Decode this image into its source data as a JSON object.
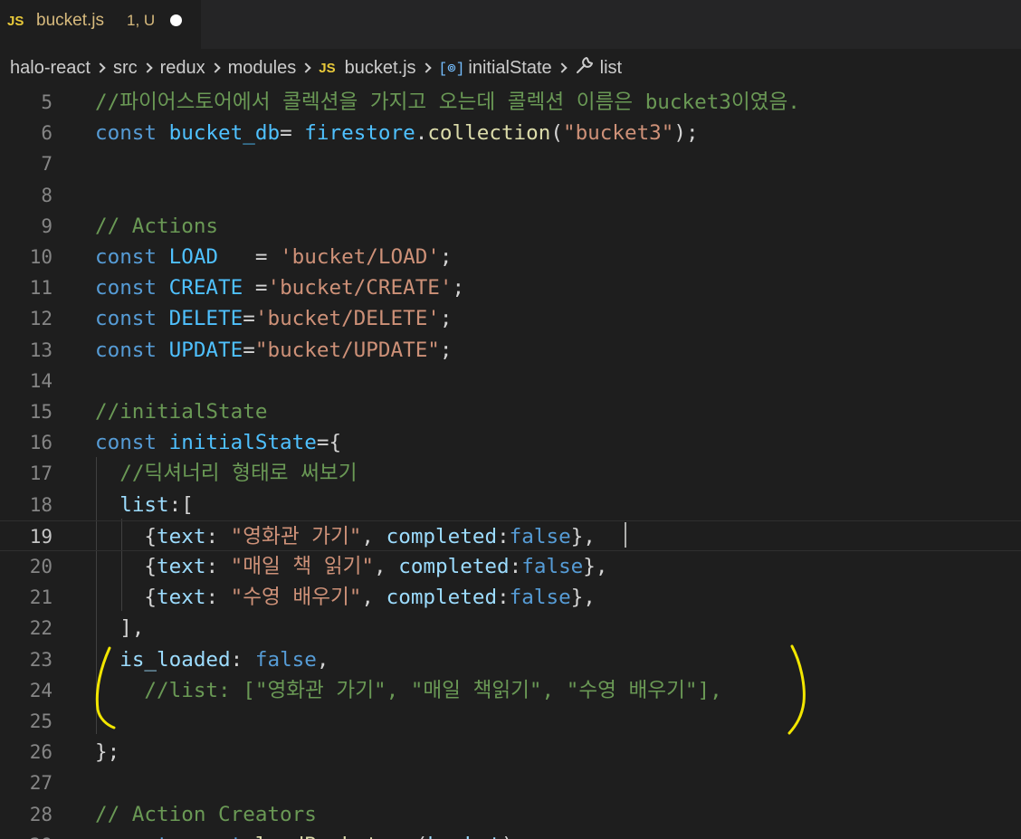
{
  "tab": {
    "icon": "JS",
    "title": "bucket.js",
    "status": "1, U"
  },
  "breadcrumb": {
    "items": [
      "halo-react",
      "src",
      "redux",
      "modules"
    ],
    "file_icon": "JS",
    "file": "bucket.js",
    "symbol_icon": "[⊚]",
    "symbol": "initialState",
    "property": "list"
  },
  "editor": {
    "lines": [
      {
        "num": "5",
        "current": false,
        "tokens": [
          [
            "cmt",
            "//파이어스토어에서 콜렉션을 가지고 오는데 콜렉션 이름은 bucket3이였음."
          ]
        ]
      },
      {
        "num": "6",
        "current": false,
        "tokens": [
          [
            "kw",
            "const"
          ],
          [
            "pun",
            " "
          ],
          [
            "var",
            "bucket_db"
          ],
          [
            "pun",
            "= "
          ],
          [
            "var",
            "firestore"
          ],
          [
            "pun",
            "."
          ],
          [
            "fn",
            "collection"
          ],
          [
            "pun",
            "("
          ],
          [
            "str",
            "\"bucket3\""
          ],
          [
            "pun",
            ");"
          ]
        ]
      },
      {
        "num": "7",
        "current": false,
        "tokens": []
      },
      {
        "num": "8",
        "current": false,
        "tokens": []
      },
      {
        "num": "9",
        "current": false,
        "tokens": [
          [
            "cmt",
            "// Actions"
          ]
        ]
      },
      {
        "num": "10",
        "current": false,
        "tokens": [
          [
            "kw",
            "const"
          ],
          [
            "pun",
            " "
          ],
          [
            "var",
            "LOAD"
          ],
          [
            "pun",
            "   = "
          ],
          [
            "str",
            "'bucket/LOAD'"
          ],
          [
            "pun",
            ";"
          ]
        ]
      },
      {
        "num": "11",
        "current": false,
        "tokens": [
          [
            "kw",
            "const"
          ],
          [
            "pun",
            " "
          ],
          [
            "var",
            "CREATE"
          ],
          [
            "pun",
            " ="
          ],
          [
            "str",
            "'bucket/CREATE'"
          ],
          [
            "pun",
            ";"
          ]
        ]
      },
      {
        "num": "12",
        "current": false,
        "tokens": [
          [
            "kw",
            "const"
          ],
          [
            "pun",
            " "
          ],
          [
            "var",
            "DELETE"
          ],
          [
            "pun",
            "="
          ],
          [
            "str",
            "'bucket/DELETE'"
          ],
          [
            "pun",
            ";"
          ]
        ]
      },
      {
        "num": "13",
        "current": false,
        "tokens": [
          [
            "kw",
            "const"
          ],
          [
            "pun",
            " "
          ],
          [
            "var",
            "UPDATE"
          ],
          [
            "pun",
            "="
          ],
          [
            "str",
            "\"bucket/UPDATE\""
          ],
          [
            "pun",
            ";"
          ]
        ]
      },
      {
        "num": "14",
        "current": false,
        "tokens": []
      },
      {
        "num": "15",
        "current": false,
        "tokens": [
          [
            "cmt",
            "//initialState"
          ]
        ]
      },
      {
        "num": "16",
        "current": false,
        "tokens": [
          [
            "kw",
            "const"
          ],
          [
            "pun",
            " "
          ],
          [
            "var",
            "initialState"
          ],
          [
            "pun",
            "={"
          ]
        ]
      },
      {
        "num": "17",
        "current": false,
        "tokens": [
          [
            "pun",
            "  "
          ],
          [
            "cmt",
            "//딕셔너리 형태로 써보기"
          ]
        ]
      },
      {
        "num": "18",
        "current": false,
        "tokens": [
          [
            "pun",
            "  "
          ],
          [
            "prop",
            "list"
          ],
          [
            "pun",
            ":["
          ]
        ]
      },
      {
        "num": "19",
        "current": true,
        "tokens": [
          [
            "pun",
            "    {"
          ],
          [
            "prop",
            "text"
          ],
          [
            "pun",
            ": "
          ],
          [
            "str",
            "\"영화관 가기\""
          ],
          [
            "pun",
            ", "
          ],
          [
            "prop",
            "completed"
          ],
          [
            "pun",
            ":"
          ],
          [
            "bool",
            "false"
          ],
          [
            "pun",
            "},"
          ]
        ]
      },
      {
        "num": "20",
        "current": false,
        "tokens": [
          [
            "pun",
            "    {"
          ],
          [
            "prop",
            "text"
          ],
          [
            "pun",
            ": "
          ],
          [
            "str",
            "\"매일 책 읽기\""
          ],
          [
            "pun",
            ", "
          ],
          [
            "prop",
            "completed"
          ],
          [
            "pun",
            ":"
          ],
          [
            "bool",
            "false"
          ],
          [
            "pun",
            "},"
          ]
        ]
      },
      {
        "num": "21",
        "current": false,
        "tokens": [
          [
            "pun",
            "    {"
          ],
          [
            "prop",
            "text"
          ],
          [
            "pun",
            ": "
          ],
          [
            "str",
            "\"수영 배우기\""
          ],
          [
            "pun",
            ", "
          ],
          [
            "prop",
            "completed"
          ],
          [
            "pun",
            ":"
          ],
          [
            "bool",
            "false"
          ],
          [
            "pun",
            "},"
          ]
        ]
      },
      {
        "num": "22",
        "current": false,
        "tokens": [
          [
            "pun",
            "  ],"
          ]
        ]
      },
      {
        "num": "23",
        "current": false,
        "tokens": [
          [
            "pun",
            "  "
          ],
          [
            "prop",
            "is_loaded"
          ],
          [
            "pun",
            ": "
          ],
          [
            "bool",
            "false"
          ],
          [
            "pun",
            ","
          ]
        ]
      },
      {
        "num": "24",
        "current": false,
        "tokens": [
          [
            "pun",
            "    "
          ],
          [
            "cmt",
            "//list: [\"영화관 가기\", \"매일 책읽기\", \"수영 배우기\"],"
          ]
        ]
      },
      {
        "num": "25",
        "current": false,
        "tokens": []
      },
      {
        "num": "26",
        "current": false,
        "tokens": [
          [
            "pun",
            "};"
          ]
        ]
      },
      {
        "num": "27",
        "current": false,
        "tokens": []
      },
      {
        "num": "28",
        "current": false,
        "tokens": [
          [
            "cmt",
            "// Action Creators"
          ]
        ]
      },
      {
        "num": "29",
        "current": false,
        "tokens": [
          [
            "kw",
            "export"
          ],
          [
            "pun",
            " "
          ],
          [
            "kw",
            "const"
          ],
          [
            "pun",
            " "
          ],
          [
            "fn",
            "loadBucket"
          ],
          [
            "pun",
            " = ("
          ],
          [
            "prop",
            "bucket"
          ],
          [
            "pun",
            ")"
          ]
        ]
      }
    ]
  },
  "colors": {
    "background": "#1e1e1e",
    "annotation": "#f2e600",
    "keyword": "#569cd6",
    "string": "#ce9178",
    "comment": "#6a9955"
  }
}
